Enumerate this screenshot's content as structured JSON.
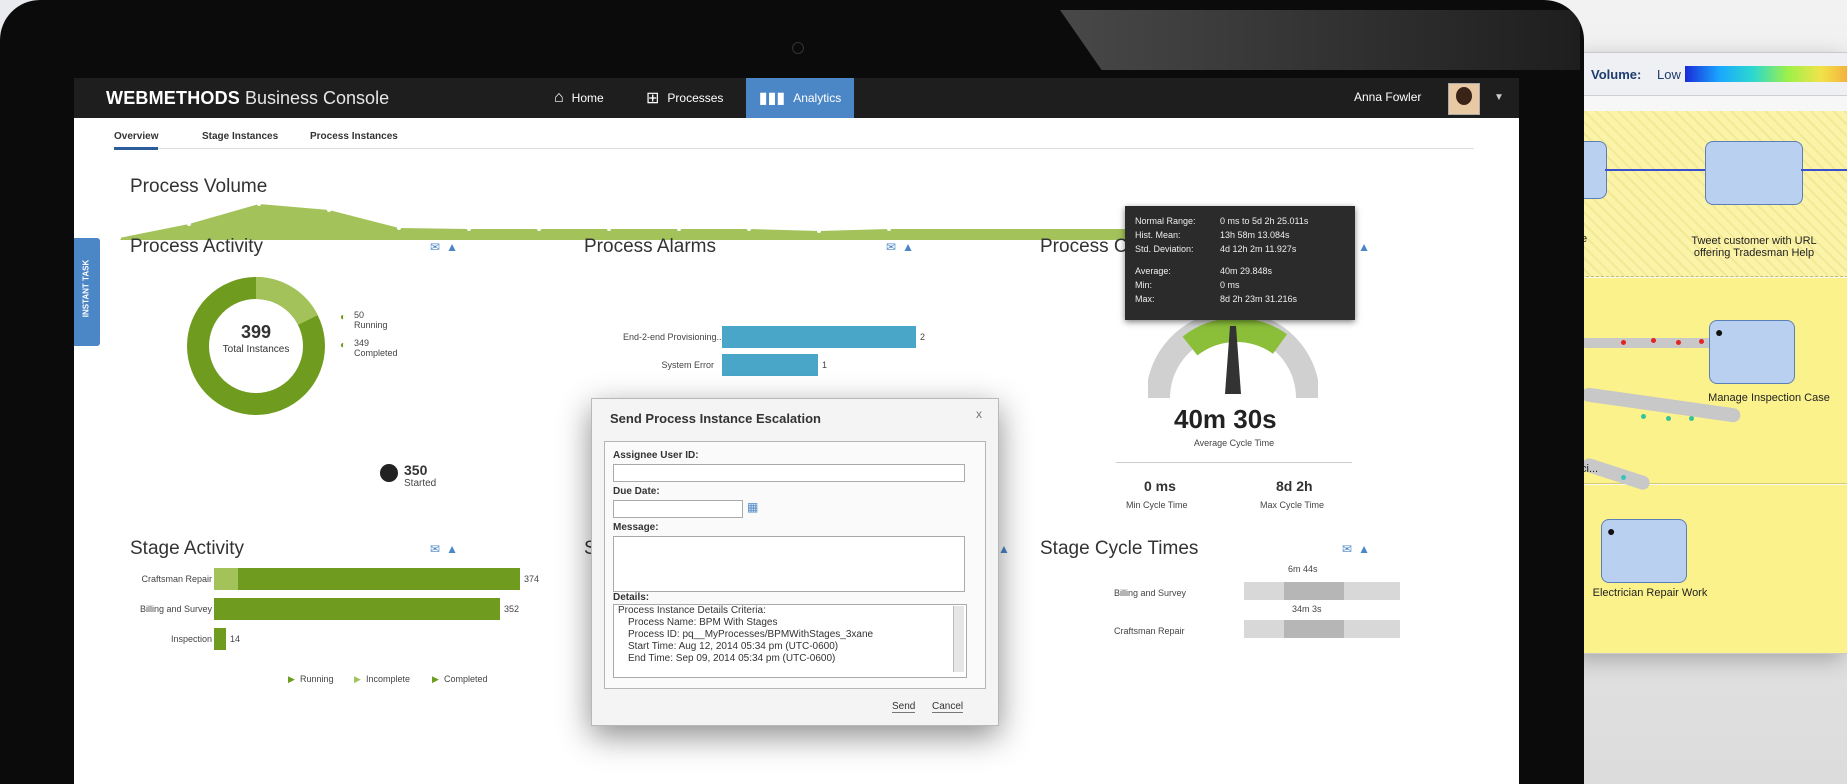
{
  "app": {
    "brand_bold": "WEBMETHODS",
    "brand_rest": " Business Console",
    "nav": [
      {
        "label": "Home",
        "icon": "home-icon"
      },
      {
        "label": "Processes",
        "icon": "process-flow-icon"
      },
      {
        "label": "Analytics",
        "icon": "bar-chart-icon"
      }
    ],
    "user": "Anna Fowler",
    "side_tab": "INSTANT TASK"
  },
  "tabs": [
    "Overview",
    "Stage Instances",
    "Process Instances"
  ],
  "process_volume": {
    "title": "Process Volume"
  },
  "process_activity": {
    "title": "Process Activity",
    "total": "399",
    "total_label": "Total Instances",
    "running_value": "50",
    "running_label": "Running",
    "completed_value": "349",
    "completed_label": "Completed",
    "started_value": "350",
    "started_label": "Started"
  },
  "process_alarms": {
    "title": "Process Alarms",
    "rows": [
      {
        "label": "End-2-end Provisioning...",
        "value": "2"
      },
      {
        "label": "System Error",
        "value": "1"
      }
    ]
  },
  "process_cycle": {
    "title": "Process C",
    "average": "40m 30s",
    "average_label": "Average Cycle Time",
    "min": "0 ms",
    "min_label": "Min Cycle Time",
    "max": "8d 2h",
    "max_label": "Max Cycle Time"
  },
  "tooltip": {
    "rows": [
      {
        "k": "Normal Range:",
        "v": "0 ms to 5d 2h 25.011s"
      },
      {
        "k": "Hist. Mean:",
        "v": "13h 58m 13.084s"
      },
      {
        "k": "Std. Deviation:",
        "v": "4d 12h 2m 11.927s"
      },
      {
        "k": "Average:",
        "v": "40m 29.848s"
      },
      {
        "k": "Min:",
        "v": "0 ms"
      },
      {
        "k": "Max:",
        "v": "8d 2h 23m 31.216s"
      }
    ]
  },
  "stage_activity": {
    "title": "Stage Activity",
    "rows": [
      {
        "label": "Craftsman Repair",
        "value": "374"
      },
      {
        "label": "Billing and Survey",
        "value": "352"
      },
      {
        "label": "Inspection",
        "value": "14"
      }
    ],
    "legend": [
      "Running",
      "Incomplete",
      "Completed"
    ]
  },
  "stage_middle": {
    "title": "S"
  },
  "stage_cycle": {
    "title": "Stage Cycle Times",
    "rows": [
      {
        "label": "Billing and Survey",
        "value": "6m 44s"
      },
      {
        "label": "Craftsman Repair",
        "value": "34m 3s"
      }
    ]
  },
  "dialog": {
    "title": "Send Process Instance Escalation",
    "close": "x",
    "assignee_label": "Assignee User ID:",
    "due_label": "Due Date:",
    "message_label": "Message:",
    "details_label": "Details:",
    "details_lines": [
      "Process Instance Details Criteria:",
      "Process Name: BPM With Stages",
      "Process ID: pq__MyProcesses/BPMWithStages_3xane",
      "Start Time: Aug 12, 2014 05:34 pm (UTC-0600)",
      "End Time: Sep 09, 2014 05:34 pm (UTC-0600)"
    ],
    "send": "Send",
    "cancel": "Cancel"
  },
  "diagram": {
    "volume_label": "Volume:",
    "volume_low": "Low",
    "task1": "Tweet customer with URL offering Tradesman Help",
    "task1_left": "e",
    "task2": "Manage Inspection Case",
    "task3": "Electrician Repair Work",
    "edge_label": "ci..."
  },
  "colors": {
    "accent": "#4b86c6",
    "green": "#6f9c1f",
    "light_green": "#a3c35a",
    "alarm_blue": "#4aa6c9"
  }
}
